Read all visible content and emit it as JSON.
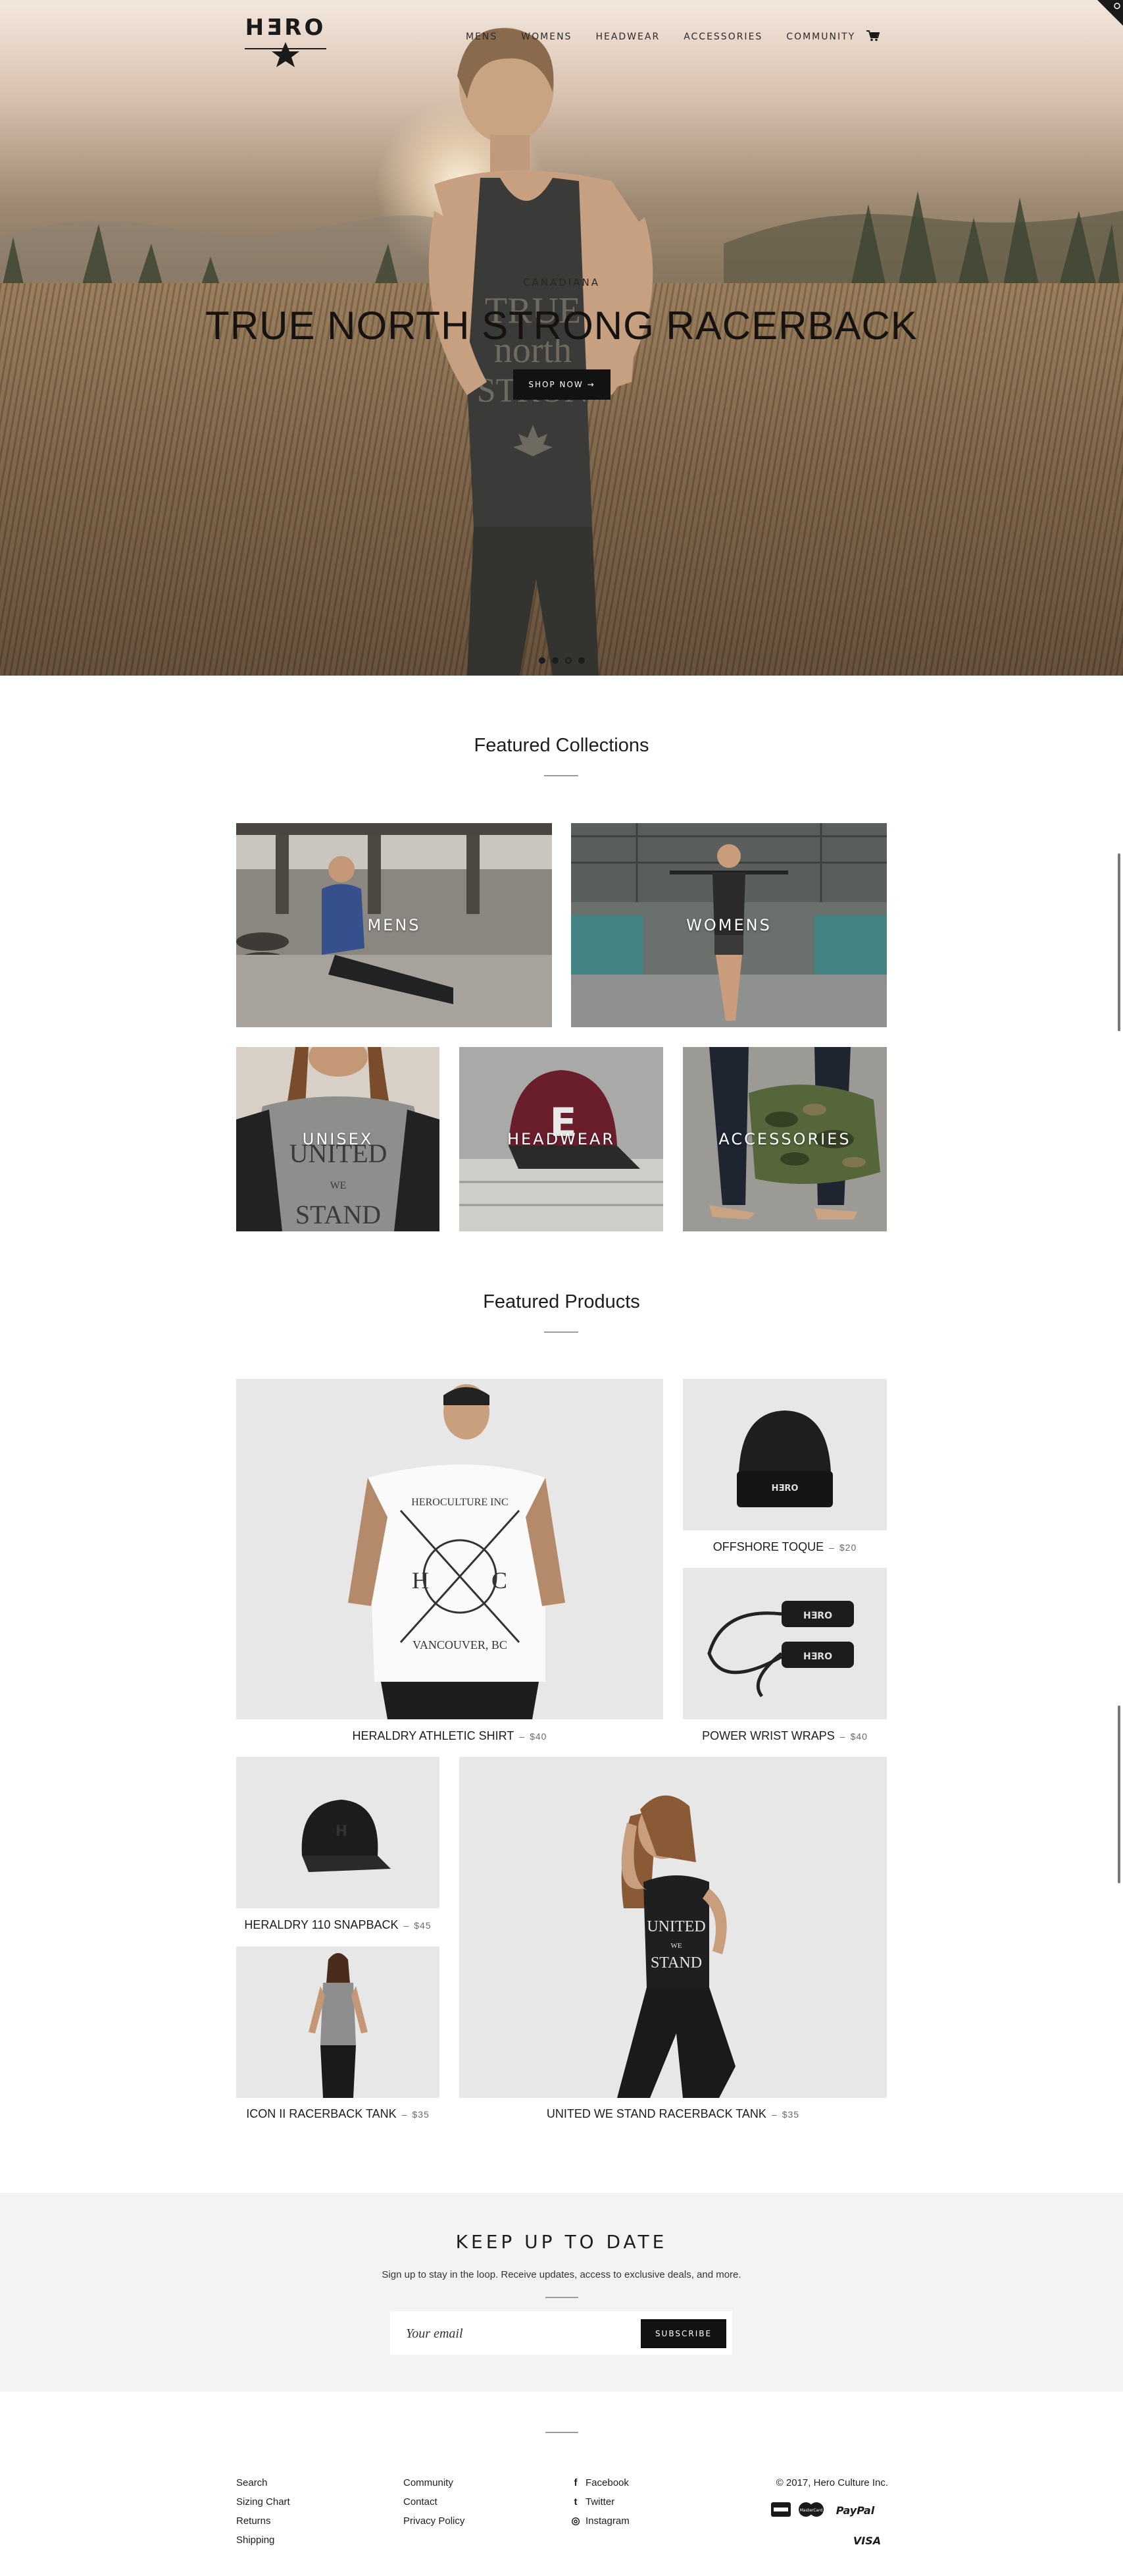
{
  "header": {
    "logo_text": "HƎRO",
    "nav": [
      "MENS",
      "WOMENS",
      "HEADWEAR",
      "ACCESSORIES",
      "COMMUNITY"
    ],
    "cart_icon": "cart-icon"
  },
  "hero": {
    "kicker": "CANADIANA",
    "title": "TRUE NORTH STRONG RACERBACK",
    "button": "SHOP NOW →",
    "slides": 4,
    "active_slide": 3
  },
  "featured_collections": {
    "title": "Featured Collections",
    "items": [
      "MENS",
      "WOMENS",
      "UNISEX",
      "HEADWEAR",
      "ACCESSORIES"
    ]
  },
  "featured_products": {
    "title": "Featured Products",
    "items": [
      {
        "name": "HERALDRY ATHLETIC SHIRT",
        "price": "$40"
      },
      {
        "name": "OFFSHORE TOQUE",
        "price": "$20"
      },
      {
        "name": "POWER WRIST WRAPS",
        "price": "$40"
      },
      {
        "name": "HERALDRY 110 SNAPBACK",
        "price": "$45"
      },
      {
        "name": "ICON II RACERBACK TANK",
        "price": "$35"
      },
      {
        "name": "UNITED WE STAND RACERBACK TANK",
        "price": "$35"
      }
    ],
    "price_separator": "–"
  },
  "newsletter": {
    "title": "KEEP UP TO DATE",
    "subtitle": "Sign up to stay in the loop. Receive updates, access to exclusive deals, and more.",
    "placeholder": "Your email",
    "button": "SUBSCRIBE"
  },
  "footer": {
    "col1": [
      "Search",
      "Sizing Chart",
      "Returns",
      "Shipping"
    ],
    "col2": [
      "Community",
      "Contact",
      "Privacy Policy"
    ],
    "social": [
      {
        "icon": "f",
        "label": "Facebook"
      },
      {
        "icon": "t",
        "label": "Twitter"
      },
      {
        "icon": "◎",
        "label": "Instagram"
      }
    ],
    "copyright": "© 2017, Hero Culture Inc.",
    "payments": [
      "American Express",
      "MasterCard",
      "PayPal",
      "VISA"
    ]
  }
}
